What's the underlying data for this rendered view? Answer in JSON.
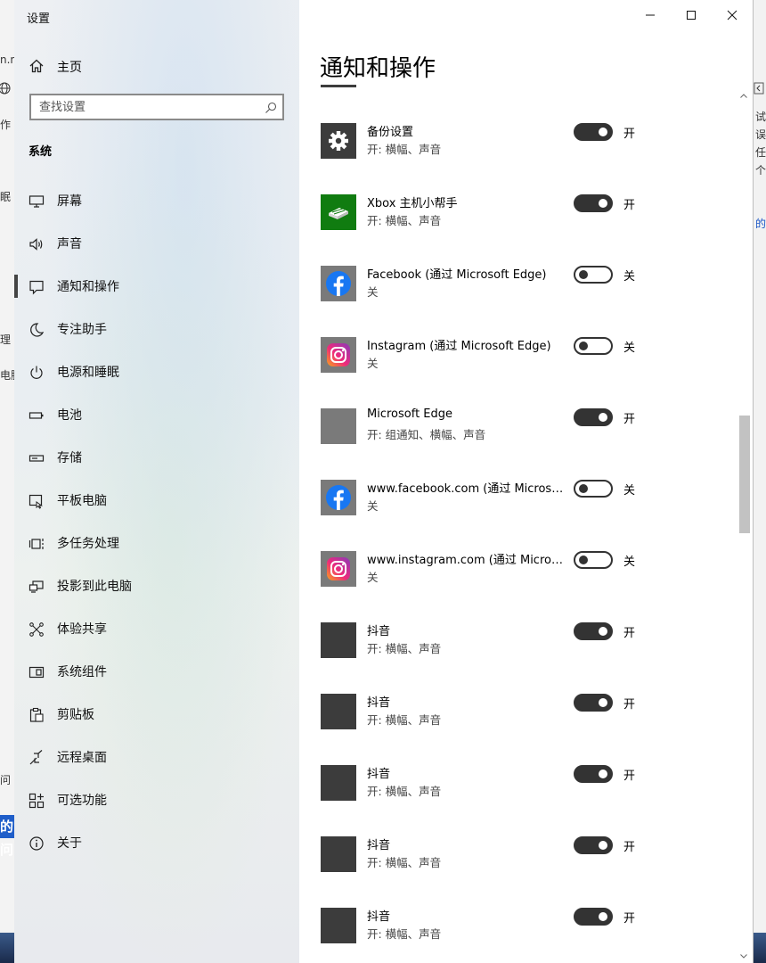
{
  "window": {
    "app_title": "设置",
    "controls": {
      "minimize": "minimize",
      "maximize": "maximize",
      "close": "close"
    }
  },
  "sidebar": {
    "home_label": "主页",
    "search_placeholder": "查找设置",
    "section_label": "系统",
    "items": [
      {
        "label": "屏幕",
        "icon": "display-icon"
      },
      {
        "label": "声音",
        "icon": "speaker-icon"
      },
      {
        "label": "通知和操作",
        "icon": "notification-icon",
        "selected": true
      },
      {
        "label": "专注助手",
        "icon": "moon-icon"
      },
      {
        "label": "电源和睡眠",
        "icon": "power-icon"
      },
      {
        "label": "电池",
        "icon": "battery-icon"
      },
      {
        "label": "存储",
        "icon": "storage-icon"
      },
      {
        "label": "平板电脑",
        "icon": "tablet-icon"
      },
      {
        "label": "多任务处理",
        "icon": "multitask-icon"
      },
      {
        "label": "投影到此电脑",
        "icon": "project-icon"
      },
      {
        "label": "体验共享",
        "icon": "share-icon"
      },
      {
        "label": "系统组件",
        "icon": "components-icon"
      },
      {
        "label": "剪贴板",
        "icon": "clipboard-icon"
      },
      {
        "label": "远程桌面",
        "icon": "remote-icon"
      },
      {
        "label": "可选功能",
        "icon": "features-icon"
      },
      {
        "label": "关于",
        "icon": "info-icon"
      }
    ]
  },
  "content": {
    "title": "通知和操作",
    "apps": [
      {
        "name": "",
        "status": "开: 横幅、声音",
        "toggle": "",
        "on": true,
        "tile": "sound-app",
        "partial": true
      },
      {
        "name": "备份设置",
        "status": "开: 横幅、声音",
        "toggle": "开",
        "on": true,
        "tile": "gear"
      },
      {
        "name": "Xbox 主机小帮手",
        "status": "开: 横幅、声音",
        "toggle": "开",
        "on": true,
        "tile": "xbox"
      },
      {
        "name": "Facebook (通过 Microsoft Edge)",
        "status": "关",
        "toggle": "关",
        "on": false,
        "tile": "facebook-framed"
      },
      {
        "name": "Instagram (通过 Microsoft Edge)",
        "status": "关",
        "toggle": "关",
        "on": false,
        "tile": "instagram-framed"
      },
      {
        "name": "Microsoft Edge",
        "status": "开: 组通知、横幅、声音",
        "toggle": "开",
        "on": true,
        "tile": "edge-gray"
      },
      {
        "name": "www.facebook.com (通过 Microsoft Edge)",
        "status": "关",
        "toggle": "关",
        "on": false,
        "tile": "facebook-framed"
      },
      {
        "name": "www.instagram.com (通过 Microsoft Edge)",
        "status": "关",
        "toggle": "关",
        "on": false,
        "tile": "instagram-framed"
      },
      {
        "name": "抖音",
        "status": "开: 横幅、声音",
        "toggle": "开",
        "on": true,
        "tile": "dark"
      },
      {
        "name": "抖音",
        "status": "开: 横幅、声音",
        "toggle": "开",
        "on": true,
        "tile": "dark"
      },
      {
        "name": "抖音",
        "status": "开: 横幅、声音",
        "toggle": "开",
        "on": true,
        "tile": "dark"
      },
      {
        "name": "抖音",
        "status": "开: 横幅、声音",
        "toggle": "开",
        "on": true,
        "tile": "dark"
      },
      {
        "name": "抖音",
        "status": "开: 横幅、声音",
        "toggle": "开",
        "on": true,
        "tile": "dark"
      }
    ]
  },
  "background": {
    "left_fragments": [
      "n.n",
      "作",
      "眠",
      "理",
      "电脑",
      "问",
      "的问"
    ],
    "right_fragments": [
      "试完",
      "误消",
      "任何",
      "个问",
      "的问"
    ]
  },
  "colors": {
    "accent_dark": "#333333",
    "xbox_green": "#107c10",
    "facebook_blue": "#1877f2",
    "tile_gray": "#7a7a7a",
    "tile_dark": "#3c3c3c"
  }
}
